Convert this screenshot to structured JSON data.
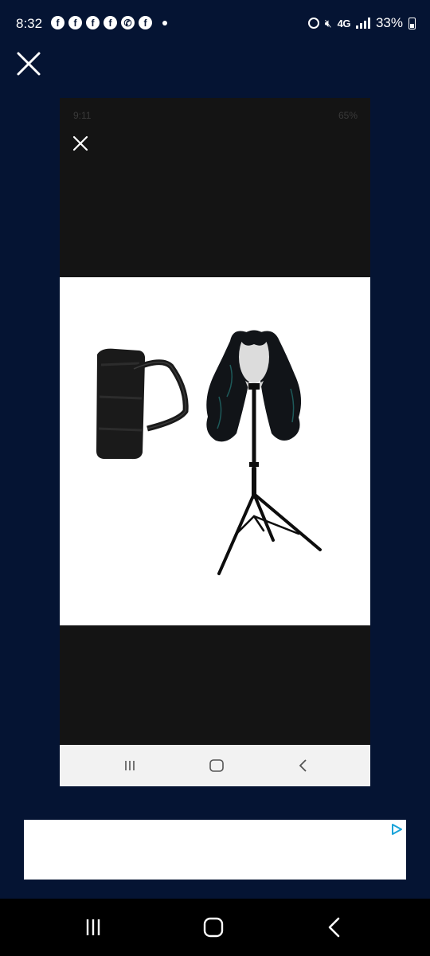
{
  "status_bar": {
    "time": "8:32",
    "notification_icons": [
      "facebook-icon",
      "facebook-icon",
      "facebook-icon",
      "facebook-icon",
      "whatsapp-icon",
      "facebook-icon"
    ],
    "network": "4G",
    "battery": "33%"
  },
  "viewer": {
    "close_icon": "close-icon"
  },
  "photo": {
    "inner_status": {
      "time": "9:11",
      "battery": "65%"
    },
    "product": {
      "bag_color": "#1a1a1a",
      "hair_color": "#111418",
      "stand_color": "#0d0d0d"
    },
    "inner_nav": [
      "recent-apps-icon",
      "home-icon",
      "back-icon"
    ]
  },
  "ad": {
    "icon": "adchoices-icon",
    "accent": "#1aa3d9"
  },
  "nav_bar": [
    "recent-apps-icon",
    "home-icon",
    "back-icon"
  ],
  "colors": {
    "background": "#051433",
    "frame": "#141414"
  }
}
